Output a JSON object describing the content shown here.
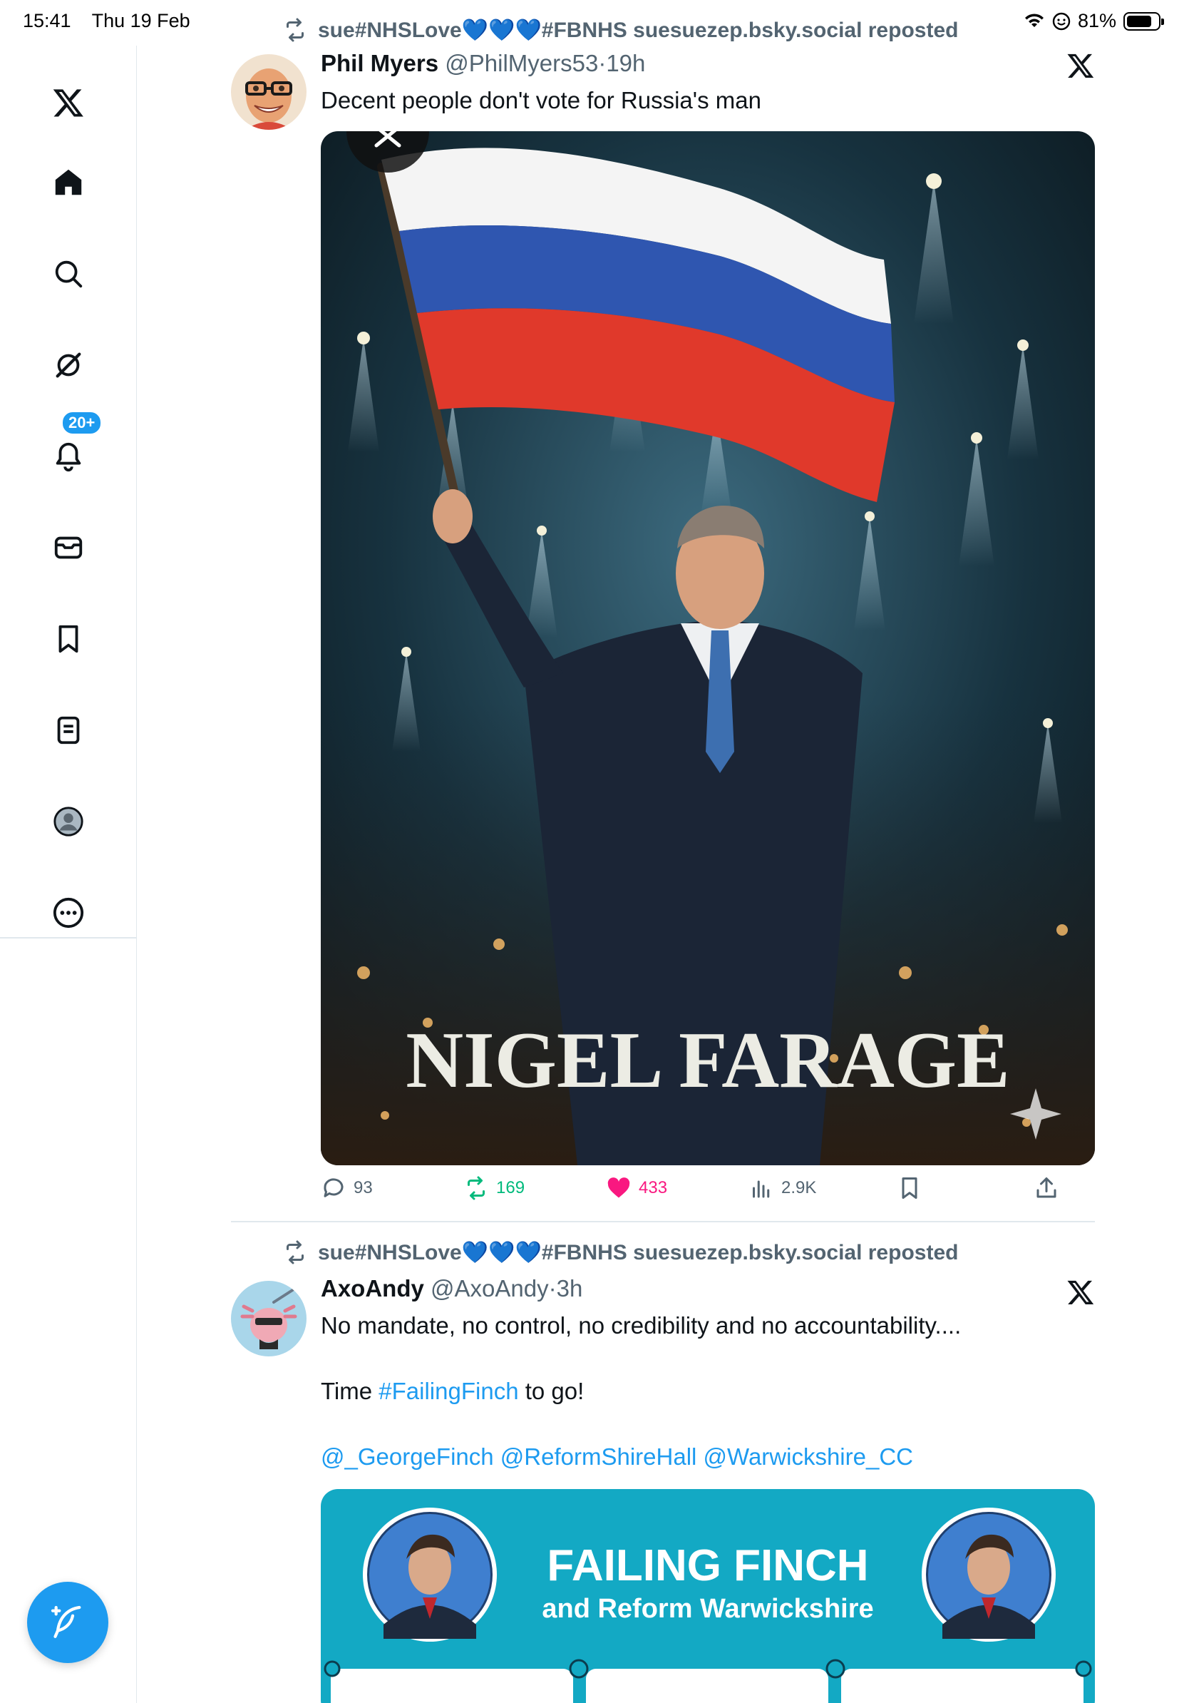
{
  "status_bar": {
    "time": "15:41",
    "date": "Thu 19 Feb",
    "battery": "81%",
    "battery_level": 0.81
  },
  "sidebar": {
    "items": [
      {
        "name": "x-logo-icon"
      },
      {
        "name": "home-icon"
      },
      {
        "name": "search-icon"
      },
      {
        "name": "grok-icon"
      },
      {
        "name": "notifications-icon"
      },
      {
        "name": "messages-icon"
      },
      {
        "name": "bookmarks-icon"
      },
      {
        "name": "lists-icon"
      },
      {
        "name": "profile-icon"
      },
      {
        "name": "more-icon"
      }
    ],
    "notification_badge": "20+",
    "compose_icon": "compose-icon"
  },
  "posts": [
    {
      "repost_line": "sue#NHSLove💙💙💙#FBNHS suesuezep.bsky.social reposted",
      "author_name": "Phil Myers",
      "handle": "@PhilMyers53",
      "dot": "·",
      "time": "19h",
      "text": "Decent people don't vote for Russia's man",
      "image_caption": "NIGEL FARAGE",
      "flag_colors": [
        "#f4f4f4",
        "#2f56b0",
        "#e0392b"
      ],
      "actions": {
        "replies": "93",
        "reposts": "169",
        "likes": "433",
        "views": "2.9K"
      }
    },
    {
      "repost_line": "sue#NHSLove💙💙💙#FBNHS suesuezep.bsky.social reposted",
      "author_name": "AxoAndy",
      "handle": "@AxoAndy",
      "dot": "·",
      "time": "3h",
      "text_line1": "No mandate, no control, no credibility and no accountability....",
      "text_line2_pre": "Time ",
      "hashtag": "#FailingFinch",
      "text_line2_post": " to go!",
      "mentions": "@_GeorgeFinch @ReformShireHall @Warwickshire_CC",
      "card_title": "FAILING FINCH",
      "card_subtitle": "and Reform Warwickshire",
      "card_color": "#13a9c4"
    }
  ],
  "colors": {
    "accent": "#1d9bf0",
    "like": "#f91880",
    "repost": "#00ba7c",
    "muted": "#536471"
  }
}
